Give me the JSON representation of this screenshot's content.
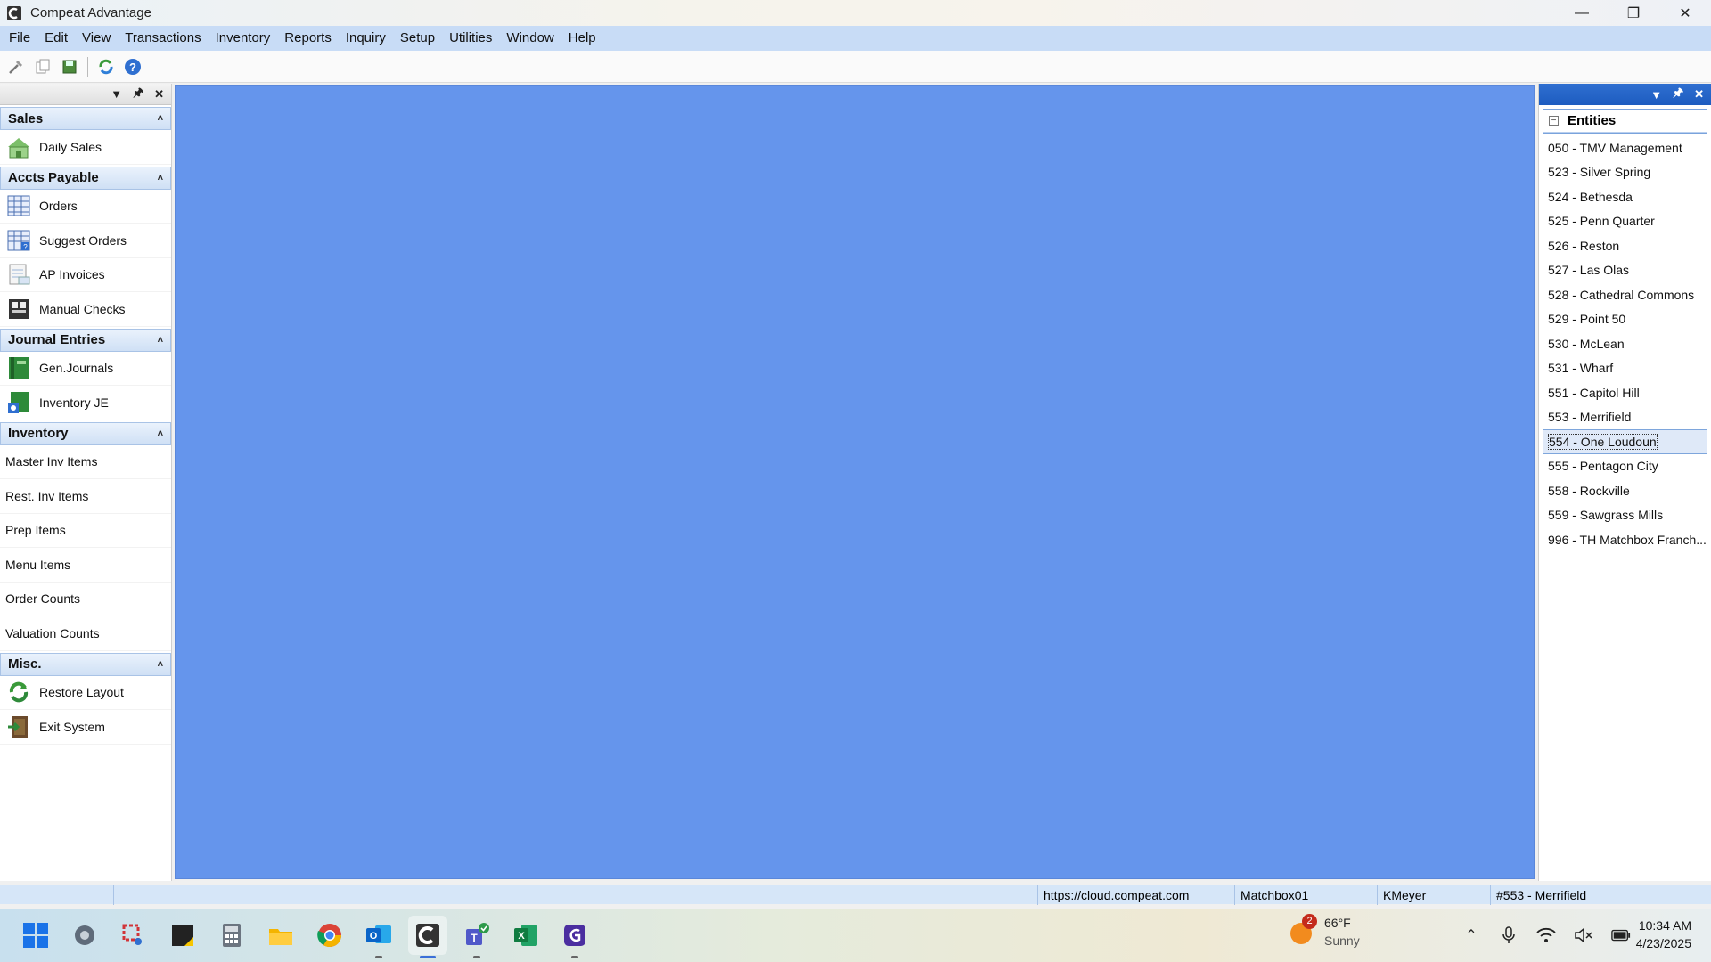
{
  "window": {
    "title": "Compeat Advantage"
  },
  "menu": [
    "File",
    "Edit",
    "View",
    "Transactions",
    "Inventory",
    "Reports",
    "Inquiry",
    "Setup",
    "Utilities",
    "Window",
    "Help"
  ],
  "toolbar": {
    "icons": [
      "tools-icon",
      "copy-icon",
      "save-icon",
      "refresh-icon",
      "help-icon"
    ]
  },
  "left_panel": {
    "groups": [
      {
        "title": "Sales",
        "items": [
          {
            "label": "Daily Sales",
            "icon": "daily-sales-icon"
          }
        ]
      },
      {
        "title": "Accts Payable",
        "items": [
          {
            "label": "Orders",
            "icon": "orders-icon"
          },
          {
            "label": "Suggest Orders",
            "icon": "suggest-orders-icon"
          },
          {
            "label": "AP Invoices",
            "icon": "invoices-icon"
          },
          {
            "label": "Manual Checks",
            "icon": "checks-icon"
          }
        ]
      },
      {
        "title": "Journal Entries",
        "items": [
          {
            "label": "Gen.Journals",
            "icon": "journals-icon"
          },
          {
            "label": "Inventory JE",
            "icon": "inventory-je-icon"
          }
        ]
      },
      {
        "title": "Inventory",
        "items": [
          {
            "label": "Master Inv Items"
          },
          {
            "label": "Rest. Inv Items"
          },
          {
            "label": "Prep Items"
          },
          {
            "label": "Menu Items"
          },
          {
            "label": "Order Counts"
          },
          {
            "label": "Valuation Counts"
          }
        ]
      },
      {
        "title": "Misc.",
        "items": [
          {
            "label": "Restore Layout",
            "icon": "restore-layout-icon"
          },
          {
            "label": "Exit System",
            "icon": "exit-icon"
          }
        ]
      }
    ]
  },
  "entities": {
    "title": "Entities",
    "selected": "554 - One Loudoun",
    "items": [
      "050 - TMV Management",
      "523 - Silver Spring",
      "524 - Bethesda",
      "525 - Penn Quarter",
      "526 - Reston",
      "527 - Las Olas",
      "528 - Cathedral Commons",
      "529 - Point 50",
      "530 - McLean",
      "531 - Wharf",
      "551 - Capitol Hill",
      "553 - Merrifield",
      "554 - One Loudoun",
      "555 - Pentagon City",
      "558 - Rockville",
      "559 - Sawgrass Mills",
      "996 - TH Matchbox Franch..."
    ]
  },
  "statusbar": {
    "url": "https://cloud.compeat.com",
    "database": "Matchbox01",
    "user": "KMeyer",
    "entity": "#553 - Merrifield"
  },
  "taskbar": {
    "apps": [
      "start-icon",
      "settings-icon",
      "snipping-tool-icon",
      "sticky-notes-icon",
      "calculator-icon",
      "file-explorer-icon",
      "chrome-icon",
      "outlook-icon",
      "compeat-icon",
      "teams-icon",
      "excel-icon",
      "app-icon"
    ],
    "weather": {
      "temp": "66°F",
      "condition": "Sunny",
      "badge": "2"
    },
    "clock": {
      "time": "10:34 AM",
      "date": "4/23/2025"
    }
  },
  "colors": {
    "mdi_background": "#6595ec",
    "menubar": "#c8dcf6",
    "accent": "#1d5cc0"
  }
}
